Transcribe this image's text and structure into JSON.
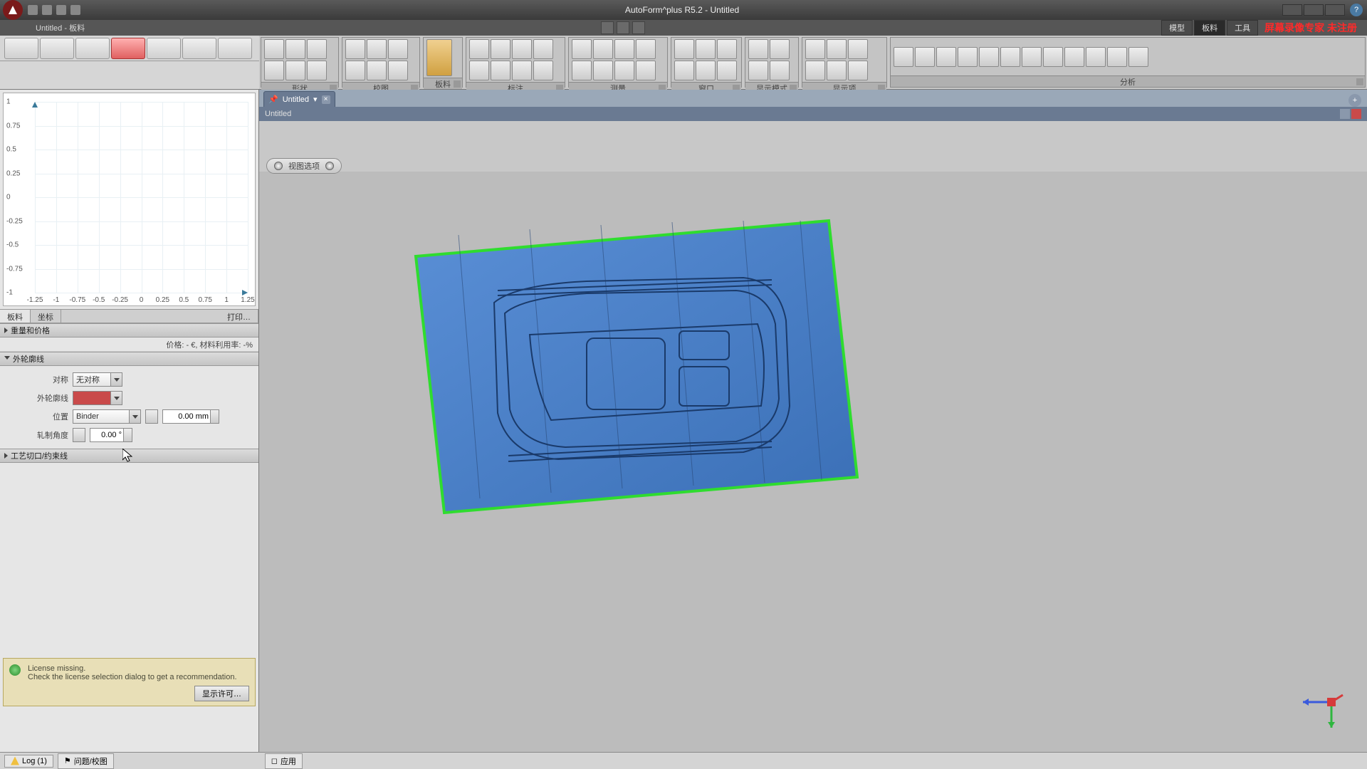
{
  "titlebar": {
    "title": "AutoForm^plus R5.2 - Untitled"
  },
  "substrip": {
    "doc_label": "Untitled - 板料",
    "modes": [
      "模型",
      "板料",
      "工具"
    ],
    "active_mode": 1,
    "watermark": "屏幕录像专家 未注册"
  },
  "ribbon_groups": {
    "g1": "形状",
    "g2": "校图",
    "g3": "板料",
    "g4": "标注",
    "g5": "测量",
    "g6": "窗口",
    "g7": "显示模式",
    "g8": "显示项",
    "g9": "分析"
  },
  "left": {
    "tabs": [
      "板料",
      "坐标"
    ],
    "print": "打印…",
    "row_weight": "重量和价格",
    "row_price": "价格: - €, 材料利用率: -%",
    "sec_outline": "外轮廓线",
    "lbl_sym": "对称",
    "val_sym": "无对称",
    "lbl_outline": "外轮廓线",
    "val_outline": "",
    "lbl_pos": "位置",
    "val_pos": "Binder",
    "val_offset": "0.00 mm",
    "lbl_angle": "轧制角度",
    "val_angle": "0.00 °",
    "sec_trim": "工艺切口/约束线",
    "license1": "License missing.",
    "license2": "Check the license selection dialog to get a recommendation.",
    "license_btn": "显示许可…"
  },
  "status": {
    "log": "Log (1)",
    "issues": "问题/校图",
    "apply": "应用"
  },
  "doc": {
    "tab": "Untitled",
    "inner": "Untitled",
    "view_pill": "视图选项"
  },
  "chart_data": {
    "type": "line",
    "title": "",
    "xlabel": "",
    "ylabel": "",
    "xlim": [
      -1.25,
      1.25
    ],
    "ylim": [
      -1.0,
      1.0
    ],
    "xticks": [
      -1.25,
      -1,
      -0.75,
      -0.5,
      -0.25,
      0,
      0.25,
      0.5,
      0.75,
      1,
      1.25
    ],
    "yticks": [
      -1,
      -0.75,
      -0.5,
      -0.25,
      0,
      0.25,
      0.5,
      0.75,
      1
    ],
    "series": []
  }
}
